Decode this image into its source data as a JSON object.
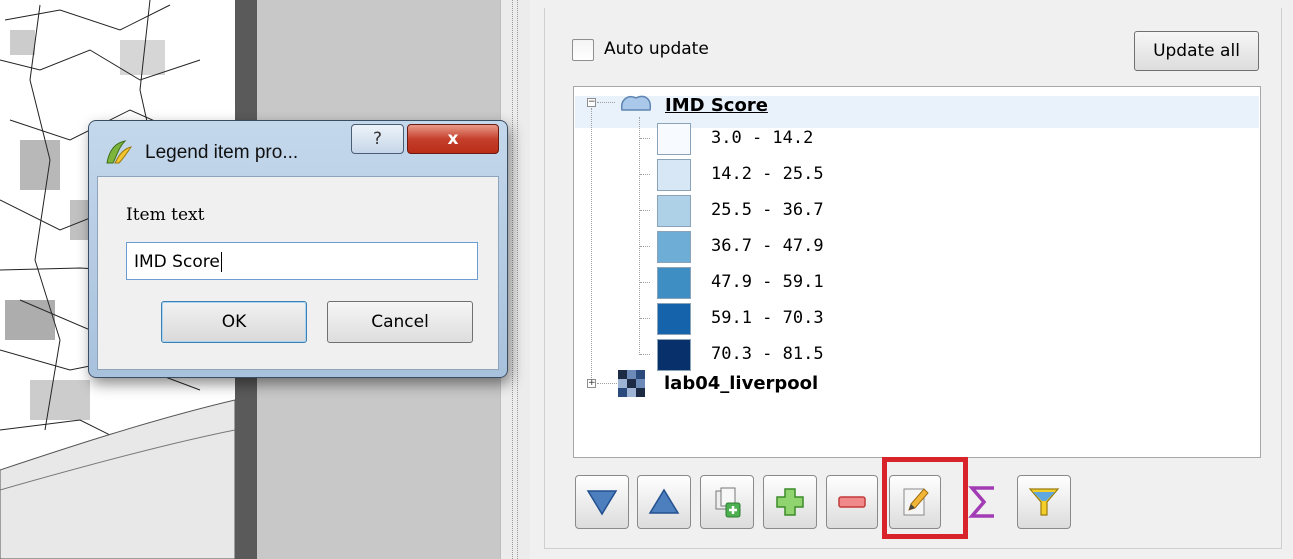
{
  "panel": {
    "auto_update_label": "Auto update",
    "update_all_label": "Update all"
  },
  "legend": {
    "layers": [
      {
        "title": "IMD Score",
        "classes": [
          {
            "label": "3.0 - 14.2",
            "color": "#f7fbff"
          },
          {
            "label": "14.2 - 25.5",
            "color": "#d7e7f6"
          },
          {
            "label": "25.5 - 36.7",
            "color": "#afd1e7"
          },
          {
            "label": "36.7 - 47.9",
            "color": "#6eaed6"
          },
          {
            "label": "47.9 - 59.1",
            "color": "#3e8ec4"
          },
          {
            "label": "59.1 - 70.3",
            "color": "#1563aa"
          },
          {
            "label": "70.3 - 81.5",
            "color": "#08306b"
          }
        ]
      },
      {
        "title": "lab04_liverpool"
      }
    ]
  },
  "toolbar": {
    "buttons": [
      {
        "name": "move-down-button",
        "icon": "triangle-down-icon"
      },
      {
        "name": "move-up-button",
        "icon": "triangle-up-icon"
      },
      {
        "name": "add-group-button",
        "icon": "add-group-icon"
      },
      {
        "name": "add-item-button",
        "icon": "plus-icon"
      },
      {
        "name": "remove-item-button",
        "icon": "minus-icon"
      },
      {
        "name": "edit-item-button",
        "icon": "pencil-icon"
      },
      {
        "name": "count-button",
        "icon": "sigma-icon"
      },
      {
        "name": "filter-button",
        "icon": "funnel-icon"
      }
    ],
    "highlight_color": "#d8232a"
  },
  "dialog": {
    "title": "Legend item pro...",
    "help_glyph": "?",
    "close_glyph": "x",
    "field_label": "Item text",
    "field_value": "IMD Score",
    "ok_label": "OK",
    "cancel_label": "Cancel"
  }
}
